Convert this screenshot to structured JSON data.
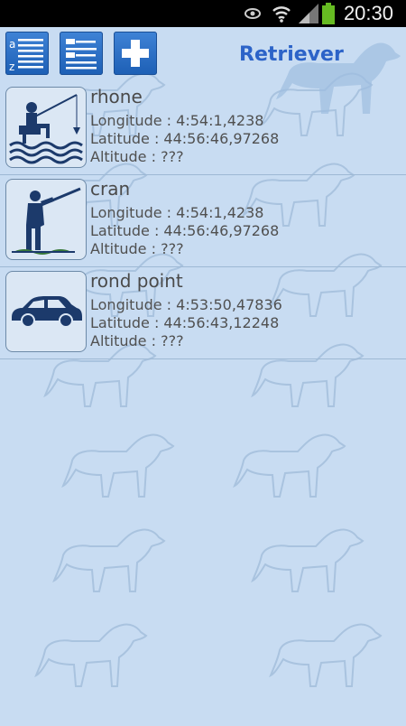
{
  "status_bar": {
    "time": "20:30",
    "icons": [
      "eye-icon",
      "wifi-icon",
      "signal-icon",
      "battery-icon"
    ]
  },
  "action_bar": {
    "title": "Retriever",
    "buttons": [
      {
        "name": "sort-alpha-button",
        "icon": "sort-alphabetical-icon"
      },
      {
        "name": "sort-list-button",
        "icon": "list-icon"
      },
      {
        "name": "add-button",
        "icon": "plus-icon"
      }
    ]
  },
  "colors": {
    "background": "#c8dcf2",
    "accent": "#2c63c8",
    "button": "#2a6fc8"
  },
  "items": [
    {
      "name": "rhone",
      "icon": "fishing-icon",
      "longitude": "Longitude : 4:54:1,4238",
      "latitude": "Latitude : 44:56:46,97268",
      "altitude": "Altitude : ???"
    },
    {
      "name": "cran",
      "icon": "hunting-icon",
      "longitude": "Longitude : 4:54:1,4238",
      "latitude": "Latitude : 44:56:46,97268",
      "altitude": "Altitude : ???"
    },
    {
      "name": "rond point",
      "icon": "car-icon",
      "longitude": "Longitude : 4:53:50,47836",
      "latitude": "Latitude : 44:56:43,12248",
      "altitude": "Altitude : ???"
    }
  ]
}
